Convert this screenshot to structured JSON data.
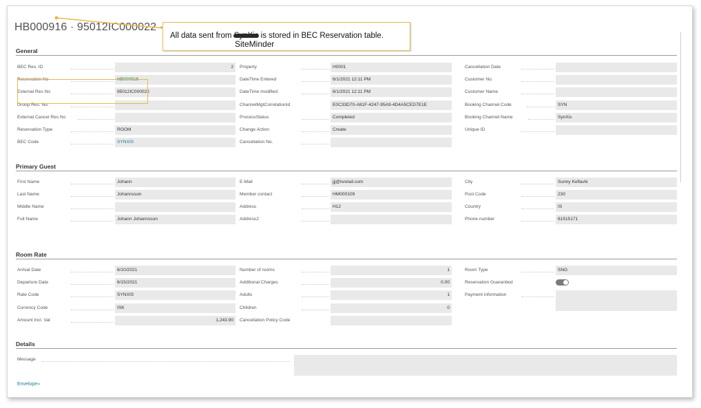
{
  "page": {
    "breadcrumb_fragment": "",
    "title": "HB000916 · 95012IC000022 · 2"
  },
  "callout": {
    "text_before": "All data sent from ",
    "redacted_word": "SynXis",
    "text_after": " is stored in BEC Reservation table.",
    "correction": "SiteMinder"
  },
  "sections": {
    "general": "General",
    "primary_guest": "Primary Guest",
    "room_rate": "Room Rate",
    "details": "Details"
  },
  "general": {
    "col1": [
      {
        "label": "BEC Res. ID",
        "value": "2"
      },
      {
        "label": "Reservation No",
        "value": "HB000916"
      },
      {
        "label": "External Res No",
        "value": "95012IC000022"
      },
      {
        "label": "Group Res. No.",
        "value": ""
      },
      {
        "label": "External Cancel Res No",
        "value": ""
      },
      {
        "label": "Reservation Type",
        "value": "ROOM"
      },
      {
        "label": "BEC Code",
        "value": "SYNXIS"
      }
    ],
    "col2": [
      {
        "label": "Property",
        "value": "H0001"
      },
      {
        "label": "DateTime Entered",
        "value": "6/1/2021 12:11 PM"
      },
      {
        "label": "DateTime modified",
        "value": "6/1/2021 12:11 PM"
      },
      {
        "label": "ChannelMgtCorrelationId",
        "value": "E0C33D70-A81F-4247-95A9-4D4A5CED7E1E"
      },
      {
        "label": "ProcessStatus",
        "value": "Completed"
      },
      {
        "label": "Change Action",
        "value": "Create"
      },
      {
        "label": "Cancellation No.",
        "value": ""
      }
    ],
    "col3": [
      {
        "label": "Cancellation Date",
        "value": ""
      },
      {
        "label": "Customer No.",
        "value": ""
      },
      {
        "label": "Customer Name",
        "value": ""
      },
      {
        "label": "Booking Channel Code",
        "value": "SYN"
      },
      {
        "label": "Booking Channel Name",
        "value": "SynXis"
      },
      {
        "label": "Unique ID",
        "value": ""
      }
    ]
  },
  "primary_guest": {
    "col1": [
      {
        "label": "First Name",
        "value": "Johann"
      },
      {
        "label": "Last Name",
        "value": "Johannsson"
      },
      {
        "label": "Middle Name",
        "value": ""
      },
      {
        "label": "Full Name",
        "value": "Johann Johannsson"
      }
    ],
    "col2": [
      {
        "label": "E-Mail",
        "value": "jjj@lsretail.com"
      },
      {
        "label": "Member contact",
        "value": "HM000109"
      },
      {
        "label": "Address",
        "value": "H12"
      },
      {
        "label": "Address2",
        "value": ""
      }
    ],
    "col3": [
      {
        "label": "City",
        "value": "Sunny Keflavik"
      },
      {
        "label": "Post Code",
        "value": "230"
      },
      {
        "label": "Country",
        "value": "IS"
      },
      {
        "label": "Phone number",
        "value": "61515171"
      }
    ]
  },
  "room_rate": {
    "col1": [
      {
        "label": "Arrival Date",
        "value": "6/10/2021"
      },
      {
        "label": "Departure Date",
        "value": "6/15/2021"
      },
      {
        "label": "Rate Code",
        "value": "SYNXIS"
      },
      {
        "label": "Currency Code",
        "value": "ISK"
      },
      {
        "label": "Amount Incl. Vat",
        "value": "1,243.90"
      }
    ],
    "col2": [
      {
        "label": "Number of rooms",
        "value": "1"
      },
      {
        "label": "Additional Charges",
        "value": "0.00"
      },
      {
        "label": "Adults",
        "value": "1"
      },
      {
        "label": "Children",
        "value": "0"
      },
      {
        "label": "Cancellation Policy Code",
        "value": ""
      }
    ],
    "col3": [
      {
        "label": "Room Type",
        "value": "SNG"
      },
      {
        "label": "Reservation Guarantied",
        "value": "on"
      },
      {
        "label": "Payment information",
        "value": ""
      }
    ]
  },
  "details": {
    "message_label": "Message",
    "message_value": "",
    "envelope_link": "Envelope»"
  }
}
